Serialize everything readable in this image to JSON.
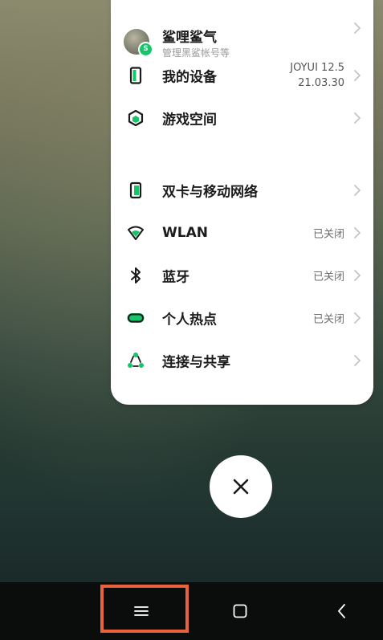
{
  "profile": {
    "name": "鲨哩鲨气",
    "subtitle": "管理黑鲨帐号等",
    "badge": "S"
  },
  "device": {
    "label": "我的设备",
    "version_line1": "JOYUI 12.5",
    "version_line2": "21.03.30"
  },
  "game_space": {
    "label": "游戏空间"
  },
  "network": {
    "items": [
      {
        "label": "双卡与移动网络",
        "value": ""
      },
      {
        "label": "WLAN",
        "value": "已关闭"
      },
      {
        "label": "蓝牙",
        "value": "已关闭"
      },
      {
        "label": "个人热点",
        "value": "已关闭"
      },
      {
        "label": "连接与共享",
        "value": ""
      }
    ]
  },
  "colors": {
    "accent": "#16c46a",
    "highlight": "#e8633a"
  },
  "icons": {
    "device": "phone-device-icon",
    "game": "hexagon-game-icon",
    "sim": "sim-card-icon",
    "wlan": "wifi-icon",
    "bluetooth": "bluetooth-icon",
    "hotspot": "hotspot-icon",
    "share": "share-connect-icon",
    "close": "close-icon",
    "menu": "menu-icon",
    "home": "home-icon",
    "back": "back-icon"
  }
}
